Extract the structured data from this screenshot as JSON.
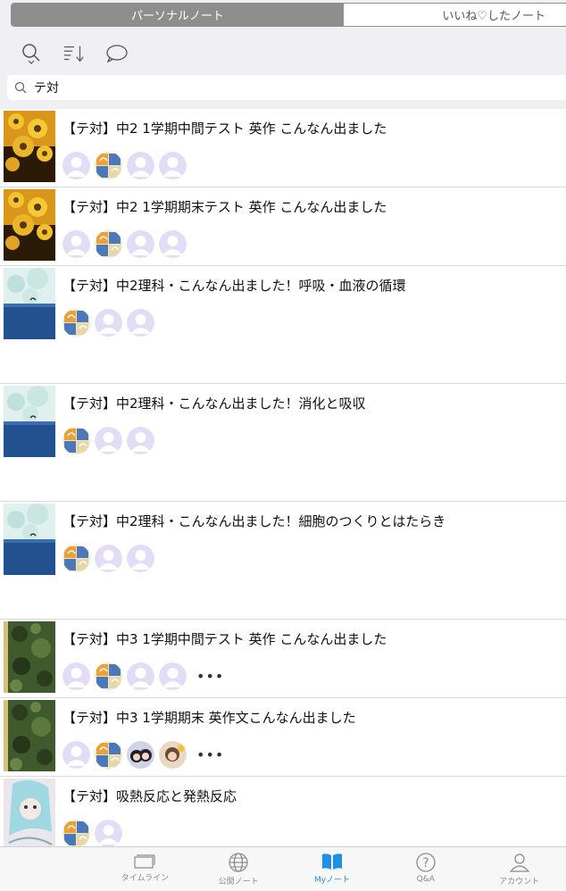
{
  "segments": {
    "personal": "パーソナルノート",
    "liked": "いいね♡したノート"
  },
  "toolbar": {
    "search_icon": "search-icon",
    "sort_icon": "sort-icon",
    "comment_icon": "comment-icon"
  },
  "search": {
    "value": "テ対"
  },
  "notes": [
    {
      "title": "【テ対】中2 1学期中間テスト 英作 こんなん出ました",
      "thumb": "sunflower",
      "avatars": [
        "blank",
        "logo",
        "blank",
        "blank"
      ],
      "more": ""
    },
    {
      "title": "【テ対】中2 1学期期末テスト 英作 こんなん出ました",
      "thumb": "sunflower",
      "avatars": [
        "blank",
        "logo",
        "blank",
        "blank"
      ],
      "more": ""
    },
    {
      "title": "【テ対】中2理科・こんなん出ました！呼吸・血液の循環",
      "thumb": "sea",
      "avatars": [
        "logo",
        "blank",
        "blank"
      ],
      "more": ""
    },
    {
      "title": "【テ対】中2理科・こんなん出ました！消化と吸収",
      "thumb": "sea",
      "avatars": [
        "logo",
        "blank",
        "blank"
      ],
      "more": ""
    },
    {
      "title": "【テ対】中2理科・こんなん出ました！細胞のつくりとはたらき",
      "thumb": "sea",
      "avatars": [
        "logo",
        "blank",
        "blank"
      ],
      "more": ""
    },
    {
      "title": "【テ対】中3 1学期中間テスト 英作 こんなん出ました",
      "thumb": "camo",
      "avatars": [
        "blank",
        "logo",
        "blank",
        "blank"
      ],
      "more": "•••"
    },
    {
      "title": "【テ対】中3 1学期期末 英作文こんなん出ました",
      "thumb": "camo",
      "avatars": [
        "blank",
        "logo",
        "photo1",
        "photo2"
      ],
      "more": "•••"
    },
    {
      "title": "【テ対】吸熱反応と発熱反応",
      "thumb": "anime",
      "avatars": [
        "logo",
        "blank"
      ],
      "more": ""
    }
  ],
  "tabbar": {
    "items": [
      {
        "label": "タイムライン",
        "icon": "timeline-icon"
      },
      {
        "label": "公開ノート",
        "icon": "globe-icon"
      },
      {
        "label": "Myノート",
        "icon": "book-icon"
      },
      {
        "label": "Q&A",
        "icon": "question-icon"
      },
      {
        "label": "アカウント",
        "icon": "account-icon"
      }
    ]
  },
  "colors": {
    "accent": "#1e90e6",
    "avatar_blank": "#e2dcf5",
    "background": "#efeff4"
  }
}
